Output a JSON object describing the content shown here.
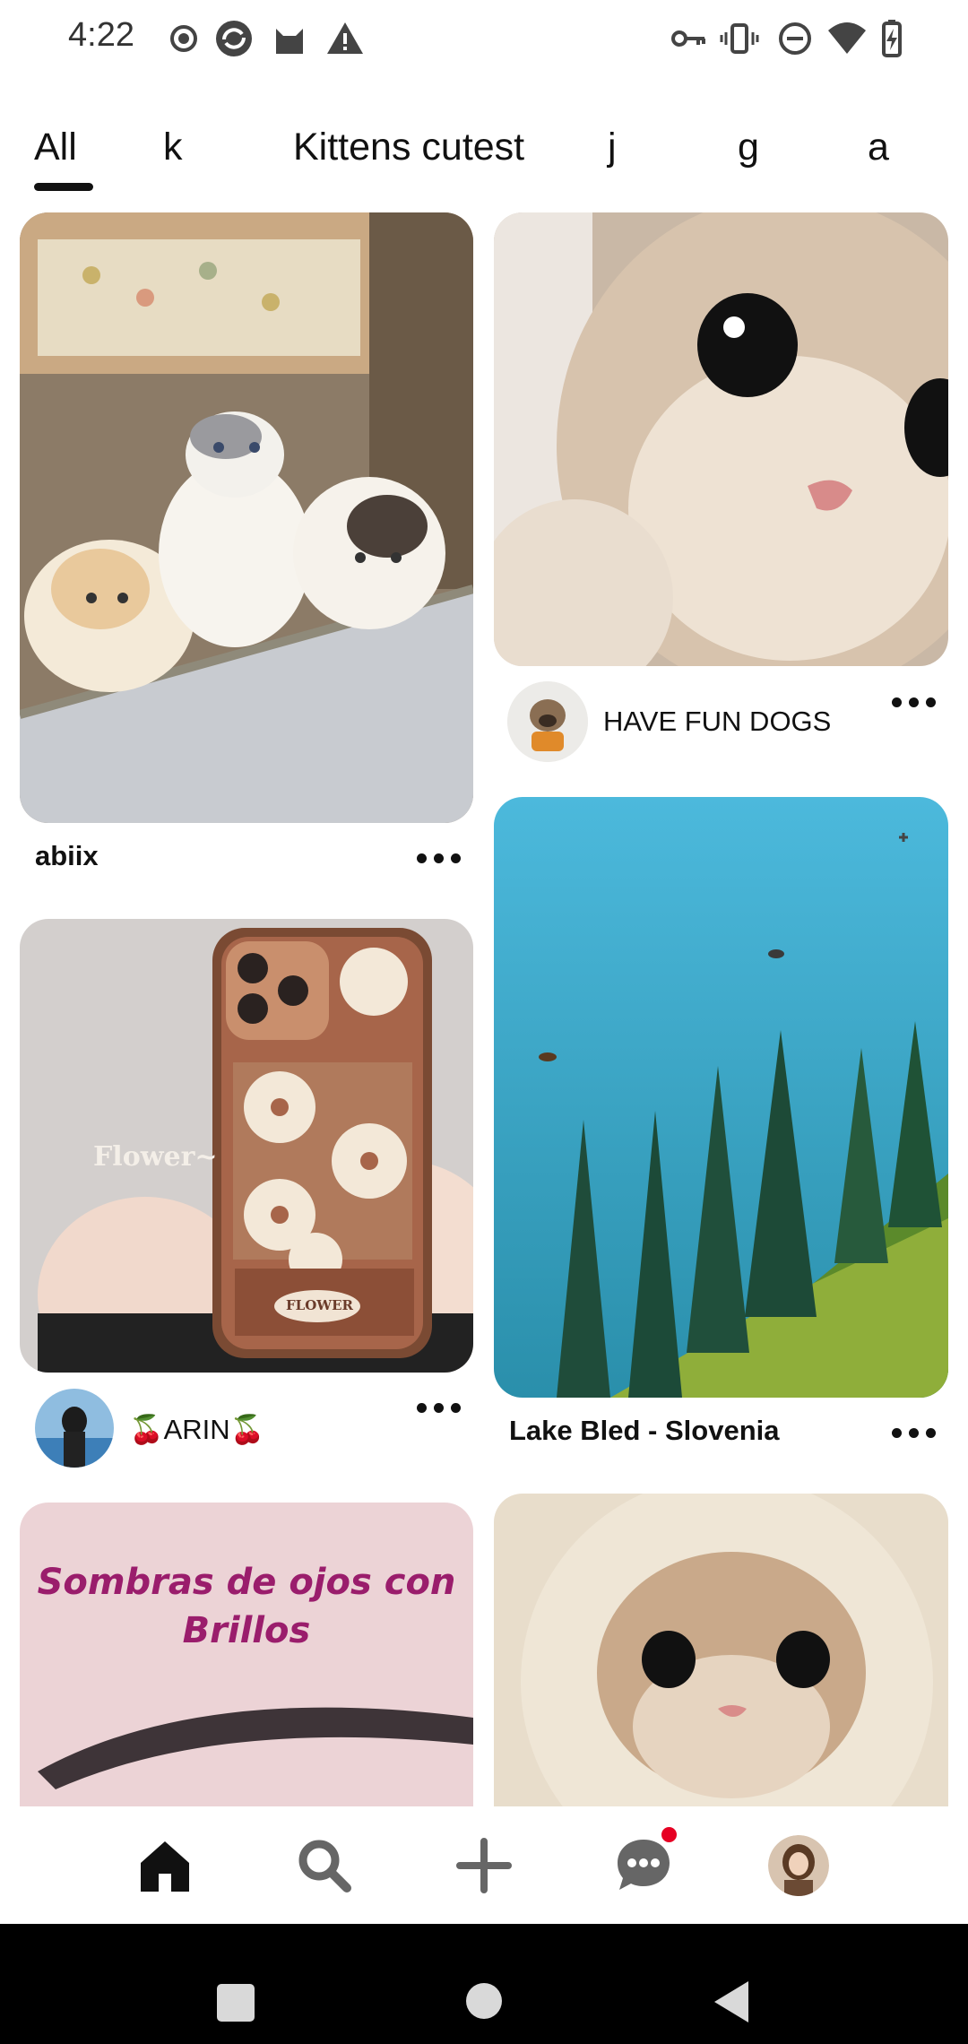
{
  "status_bar": {
    "time": "4:22",
    "left_icons": [
      "record-icon",
      "sync-icon",
      "cat-app-icon",
      "warning-icon"
    ],
    "right_icons": [
      "vpn-key-icon",
      "vibrate-icon",
      "do-not-disturb-icon",
      "wifi-icon",
      "battery-charging-icon"
    ]
  },
  "tabs": [
    {
      "label": "All",
      "active": true
    },
    {
      "label": "k",
      "active": false
    },
    {
      "label": "Kittens cutest",
      "active": false
    },
    {
      "label": "j",
      "active": false
    },
    {
      "label": "g",
      "active": false
    },
    {
      "label": "a",
      "active": false
    }
  ],
  "pins": {
    "kittens_bed": {
      "title": "abiix",
      "image": "three fluffy kittens on a bed"
    },
    "kitten_closeup": {
      "user": "HAVE FUN DOGS",
      "image": "close-up of a cream kitten's face"
    },
    "phone_case": {
      "user": "🍒ARIN🍒",
      "overlay_text": "Flower~",
      "case_label": "FLOWER",
      "image": "hands holding phone with flower case"
    },
    "lake_bled": {
      "title": "Lake Bled - Slovenia",
      "image": "aerial view of turquoise lake and pine trees"
    },
    "eyebrow": {
      "overlay_line1": "Sombras de ojos con",
      "overlay_line2": "Brillos",
      "image": "close-up of an eyebrow"
    },
    "kitten_hood": {
      "image": "kitten wrapped in a knitted hood"
    }
  },
  "more_icon": "more-horizontal-icon",
  "bottom_nav": [
    {
      "icon": "home-icon",
      "active": true
    },
    {
      "icon": "search-icon",
      "active": false
    },
    {
      "icon": "add-icon",
      "active": false
    },
    {
      "icon": "messages-icon",
      "active": false,
      "notification": true
    },
    {
      "icon": "profile-avatar",
      "active": false
    }
  ],
  "system_nav": [
    "recent-apps-icon",
    "home-circle-icon",
    "back-icon"
  ],
  "colors": {
    "accent": "#111111",
    "notification_dot": "#e60023",
    "background": "#ffffff"
  }
}
